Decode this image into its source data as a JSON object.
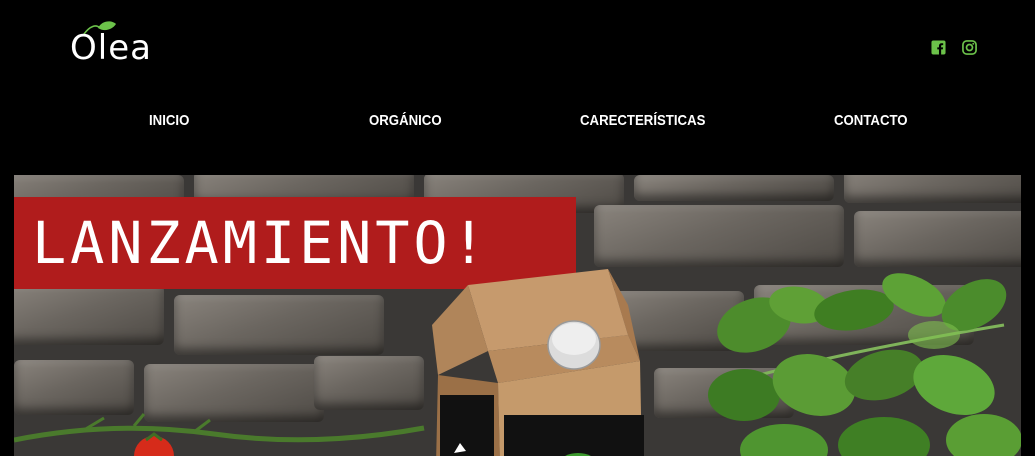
{
  "brand": {
    "name": "Olea",
    "accent": "#6cc24a"
  },
  "social": [
    {
      "name": "facebook-icon"
    },
    {
      "name": "instagram-icon"
    }
  ],
  "nav": {
    "items": [
      {
        "label": "INICIO"
      },
      {
        "label": "ORGÁNICO"
      },
      {
        "label": "CARECTERÍSTICAS"
      },
      {
        "label": "CONTACTO"
      }
    ]
  },
  "hero": {
    "banner_text": "LANZAMIENTO!",
    "banner_color": "#b01c1c"
  }
}
